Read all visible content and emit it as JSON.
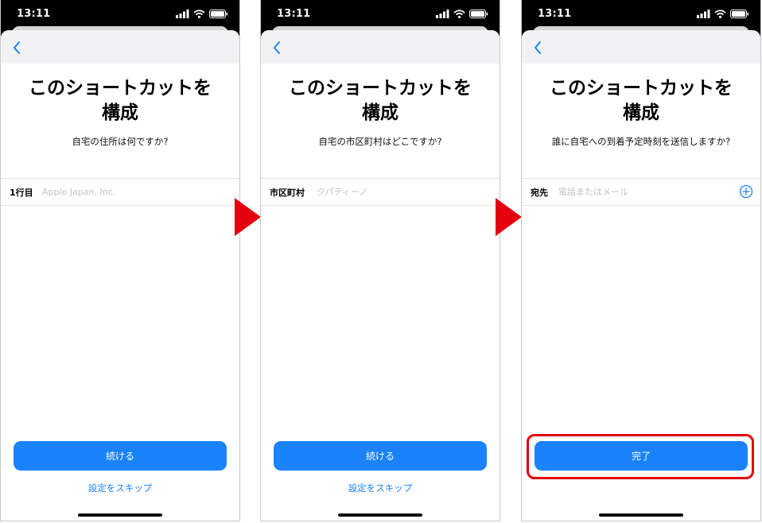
{
  "accent_color": "#1a82fb",
  "annotation_color": "#e3000f",
  "screens": [
    {
      "status_time": "13:11",
      "title_line1": "このショートカットを",
      "title_line2": "構成",
      "subtitle": "自宅の住所は何ですか?",
      "field_label": "1行目",
      "field_placeholder": "Apple Japan, Inc.",
      "field_value": "",
      "primary_button": "続ける",
      "skip_link": "設定をスキップ"
    },
    {
      "status_time": "13:11",
      "title_line1": "このショートカットを",
      "title_line2": "構成",
      "subtitle": "自宅の市区町村はどこですか?",
      "field_label": "市区町村",
      "field_placeholder": "クパティーノ",
      "field_value": "",
      "primary_button": "続ける",
      "skip_link": "設定をスキップ"
    },
    {
      "status_time": "13:11",
      "title_line1": "このショートカットを",
      "title_line2": "構成",
      "subtitle": "誰に自宅への到着予定時刻を送信しますか?",
      "field_label": "宛先",
      "field_placeholder": "電話またはメール",
      "field_value": "",
      "primary_button": "完了",
      "field_action_icon": "plus-circle-icon"
    }
  ],
  "icons": [
    "signal-icon",
    "wifi-icon",
    "battery-icon",
    "chevron-left-icon",
    "plus-circle-icon"
  ]
}
